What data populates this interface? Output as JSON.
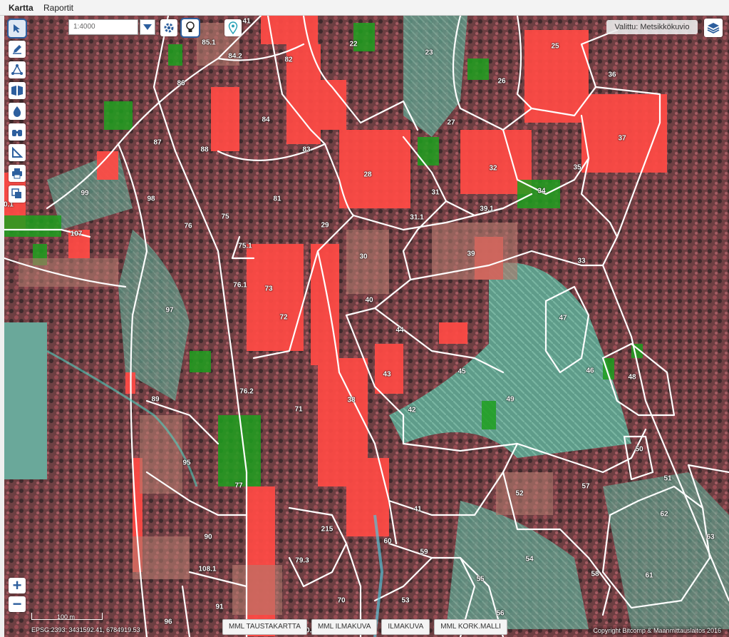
{
  "menu": {
    "tabs": [
      {
        "label": "Kartta"
      },
      {
        "label": "Raportit"
      }
    ]
  },
  "map": {
    "scale_value": "1:4000",
    "selected_layer": "Valittu: Metsikkökuvio",
    "scalebar_label": "100 m",
    "projection": "EPSG:2393",
    "coordinates": "3431592.41, 6784919.53",
    "copyright": "Copyright Bitcomp & Maanmittauslaitos 2016",
    "basemaps": [
      {
        "label": "MML TAUSTAKARTTA"
      },
      {
        "label": "MML ILMAKUVA"
      },
      {
        "label": "ILMAKUVA"
      },
      {
        "label": "MML KORK.MALLI"
      }
    ],
    "parcels": [
      "41",
      "85.1",
      "84.2",
      "22",
      "23",
      "25",
      "36",
      "82",
      "86",
      "26",
      "84",
      "27",
      "87",
      "88",
      "83",
      "37",
      "28",
      "32",
      "35",
      "99",
      "98",
      "81",
      "31",
      "34",
      "0.1",
      "39.1",
      "31.1",
      "75",
      "76",
      "29",
      "107",
      "75.1",
      "30",
      "39",
      "33",
      "76.1",
      "73",
      "40",
      "72",
      "97",
      "47",
      "44",
      "45",
      "46",
      "48",
      "43",
      "76.2",
      "38",
      "89",
      "71",
      "42",
      "49",
      "50",
      "95",
      "77",
      "57",
      "52",
      "51",
      "62",
      "41",
      "215",
      "90",
      "60",
      "59",
      "63",
      "108.1",
      "79.3",
      "54",
      "55",
      "58",
      "61",
      "70",
      "53",
      "91",
      "56",
      "96",
      "28",
      "0.1"
    ],
    "zoom_in": "+",
    "zoom_out": "−"
  },
  "colors": {
    "accent": "#2d5f9e",
    "highlight": "#ff4a45",
    "green": "#1ea01e"
  }
}
